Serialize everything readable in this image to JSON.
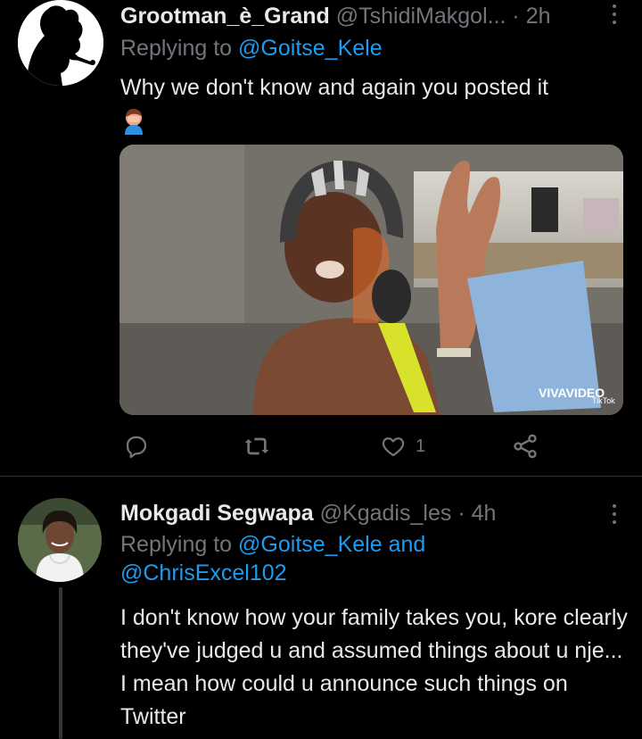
{
  "tweet1": {
    "name": "Grootman_è_Grand",
    "handle": "@TshidiMakgol...",
    "dot": "·",
    "time": "2h",
    "replying_prefix": "Replying to",
    "replying_to": "@Goitse_Kele",
    "text": "Why we don't know and again you posted it",
    "emoji": "face-palm-emoji",
    "media_watermark": "VIVAVIDEO",
    "media_tiktok": "TikTok",
    "actions": {
      "reply_icon": "reply-icon",
      "retweet_icon": "retweet-icon",
      "like_icon": "heart-icon",
      "like_count": "1",
      "share_icon": "share-icon"
    }
  },
  "tweet2": {
    "name": "Mokgadi Segwapa",
    "handle": "@Kgadis_les",
    "dot": "·",
    "time": "4h",
    "replying_prefix": "Replying to",
    "replying_to_1": "@Goitse_Kele",
    "replying_and": "and",
    "replying_to_2": "@ChrisExcel102",
    "text": "I don't know how your family takes you, kore clearly they've judged u and assumed things about u nje... I mean how could u announce such things on Twitter"
  },
  "colors": {
    "background": "#000000",
    "text": "#e7e9ea",
    "secondary": "#71767b",
    "link": "#1d9bf0",
    "divider": "#2f3336"
  }
}
